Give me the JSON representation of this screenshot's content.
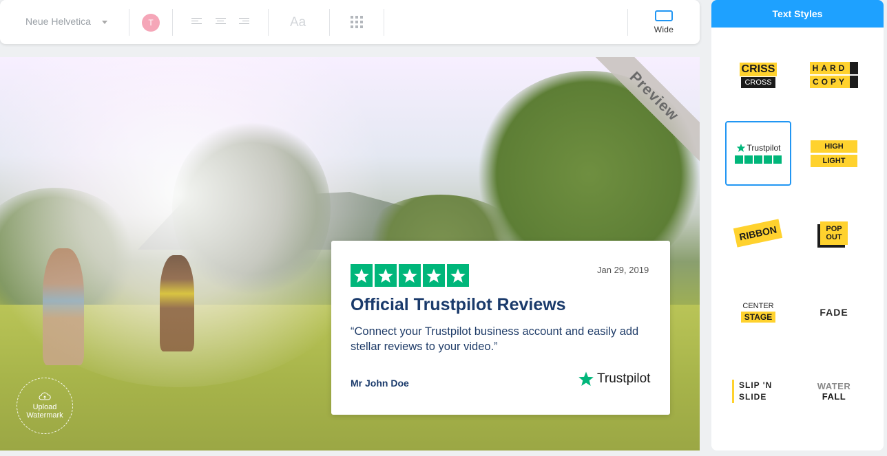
{
  "toolbar": {
    "font_name": "Neue Helvetica",
    "color_letter": "T",
    "text_style_glyph": "Aa",
    "layout_label": "Wide",
    "icons": [
      "chevron-down-icon",
      "align-left-icon",
      "align-center-icon",
      "align-right-icon",
      "grid-icon",
      "wide-layout-icon"
    ]
  },
  "preview": {
    "ribbon_label": "Preview",
    "watermark_line1": "Upload",
    "watermark_line2": "Watermark"
  },
  "review": {
    "rating_stars": 5,
    "date": "Jan 29, 2019",
    "title": "Official Trustpilot Reviews",
    "quote": "“Connect your Trustpilot business account and easily add stellar reviews to your video.”",
    "author": "Mr John Doe",
    "brand": "Trustpilot",
    "brand_color": "#00b67a"
  },
  "panel": {
    "title": "Text Styles",
    "accent": "#1ea1ff",
    "selected_style": "Trustpilot",
    "styles": [
      {
        "line1": "CRISS",
        "line2": "CROSS"
      },
      {
        "line1": "HARD",
        "line2": "COPY"
      },
      {
        "line1": "Trustpilot",
        "line2": ""
      },
      {
        "line1": "HIGH",
        "line2": "LIGHT"
      },
      {
        "line1": "RIBBON",
        "line2": ""
      },
      {
        "line1": "POP",
        "line2": "OUT"
      },
      {
        "line1": "CENTER",
        "line2": "STAGE"
      },
      {
        "line1": "FADE",
        "line2": ""
      },
      {
        "line1": "SLIP 'N",
        "line2": "SLIDE"
      },
      {
        "line1": "WATER",
        "line2": "FALL"
      }
    ]
  }
}
